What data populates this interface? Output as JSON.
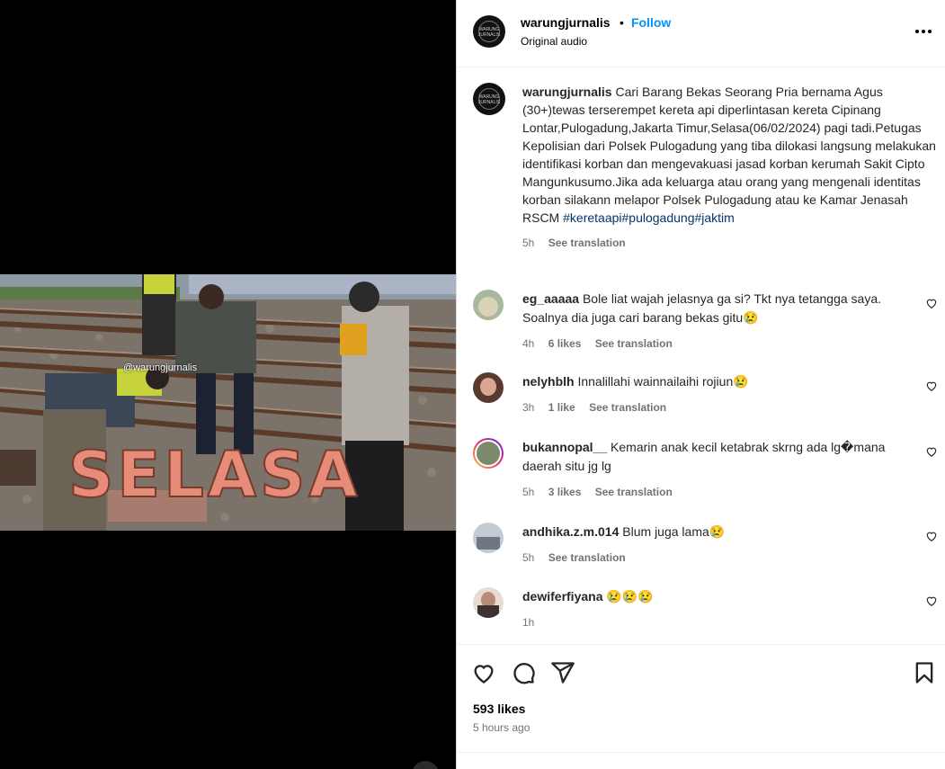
{
  "post": {
    "username": "warungjurnalis",
    "follow_label": "Follow",
    "separator": "•",
    "audio": "Original audio",
    "avatar_text": "WARUNG JURNALIS"
  },
  "video": {
    "watermark": "@warungjurnalis",
    "overlay_text": "SELASA"
  },
  "caption": {
    "username": "warungjurnalis",
    "text": "Cari Barang Bekas Seorang Pria bernama Agus (30+)tewas terserempet kereta api diperlintasan kereta Cipinang Lontar,Pulogadung,Jakarta Timur,Selasa(06/02/2024) pagi tadi.Petugas Kepolisian dari Polsek Pulogadung yang tiba dilokasi langsung melakukan identifikasi korban dan mengevakuasi jasad korban kerumah Sakit Cipto Mangunkusumo.Jika ada keluarga atau orang yang mengenali identitas korban silakann melapor Polsek Pulogadung atau ke Kamar Jenasah RSCM",
    "hashtags": "#keretaapi#pulogadung#jaktim",
    "time": "5h",
    "see_translation": "See translation"
  },
  "comments": [
    {
      "username": "eg_aaaaa",
      "text": "Bole liat wajah jelasnya ga si? Tkt nya tetangga saya. Soalnya dia juga cari barang bekas gitu😢",
      "time": "4h",
      "likes": "6 likes",
      "see_translation": "See translation"
    },
    {
      "username": "nelyhblh",
      "text": "Innalillahi wainnailaihi rojiun😢",
      "time": "3h",
      "likes": "1 like",
      "see_translation": "See translation"
    },
    {
      "username": "bukannopal__",
      "text": "Kemarin anak kecil ketabrak skrng ada lg�mana daerah situ jg lg",
      "time": "5h",
      "likes": "3 likes",
      "see_translation": "See translation"
    },
    {
      "username": "andhika.z.m.014",
      "text": "Blum juga lama😢",
      "time": "5h",
      "likes": "",
      "see_translation": "See translation"
    },
    {
      "username": "dewiferfiyana",
      "text": "😢😢😢",
      "time": "1h",
      "likes": "",
      "see_translation": ""
    }
  ],
  "footer": {
    "likes": "593 likes",
    "time_ago": "5 hours ago"
  },
  "icons": [
    "like-icon",
    "comment-icon",
    "share-icon",
    "save-icon",
    "more-icon",
    "heart-icon"
  ]
}
